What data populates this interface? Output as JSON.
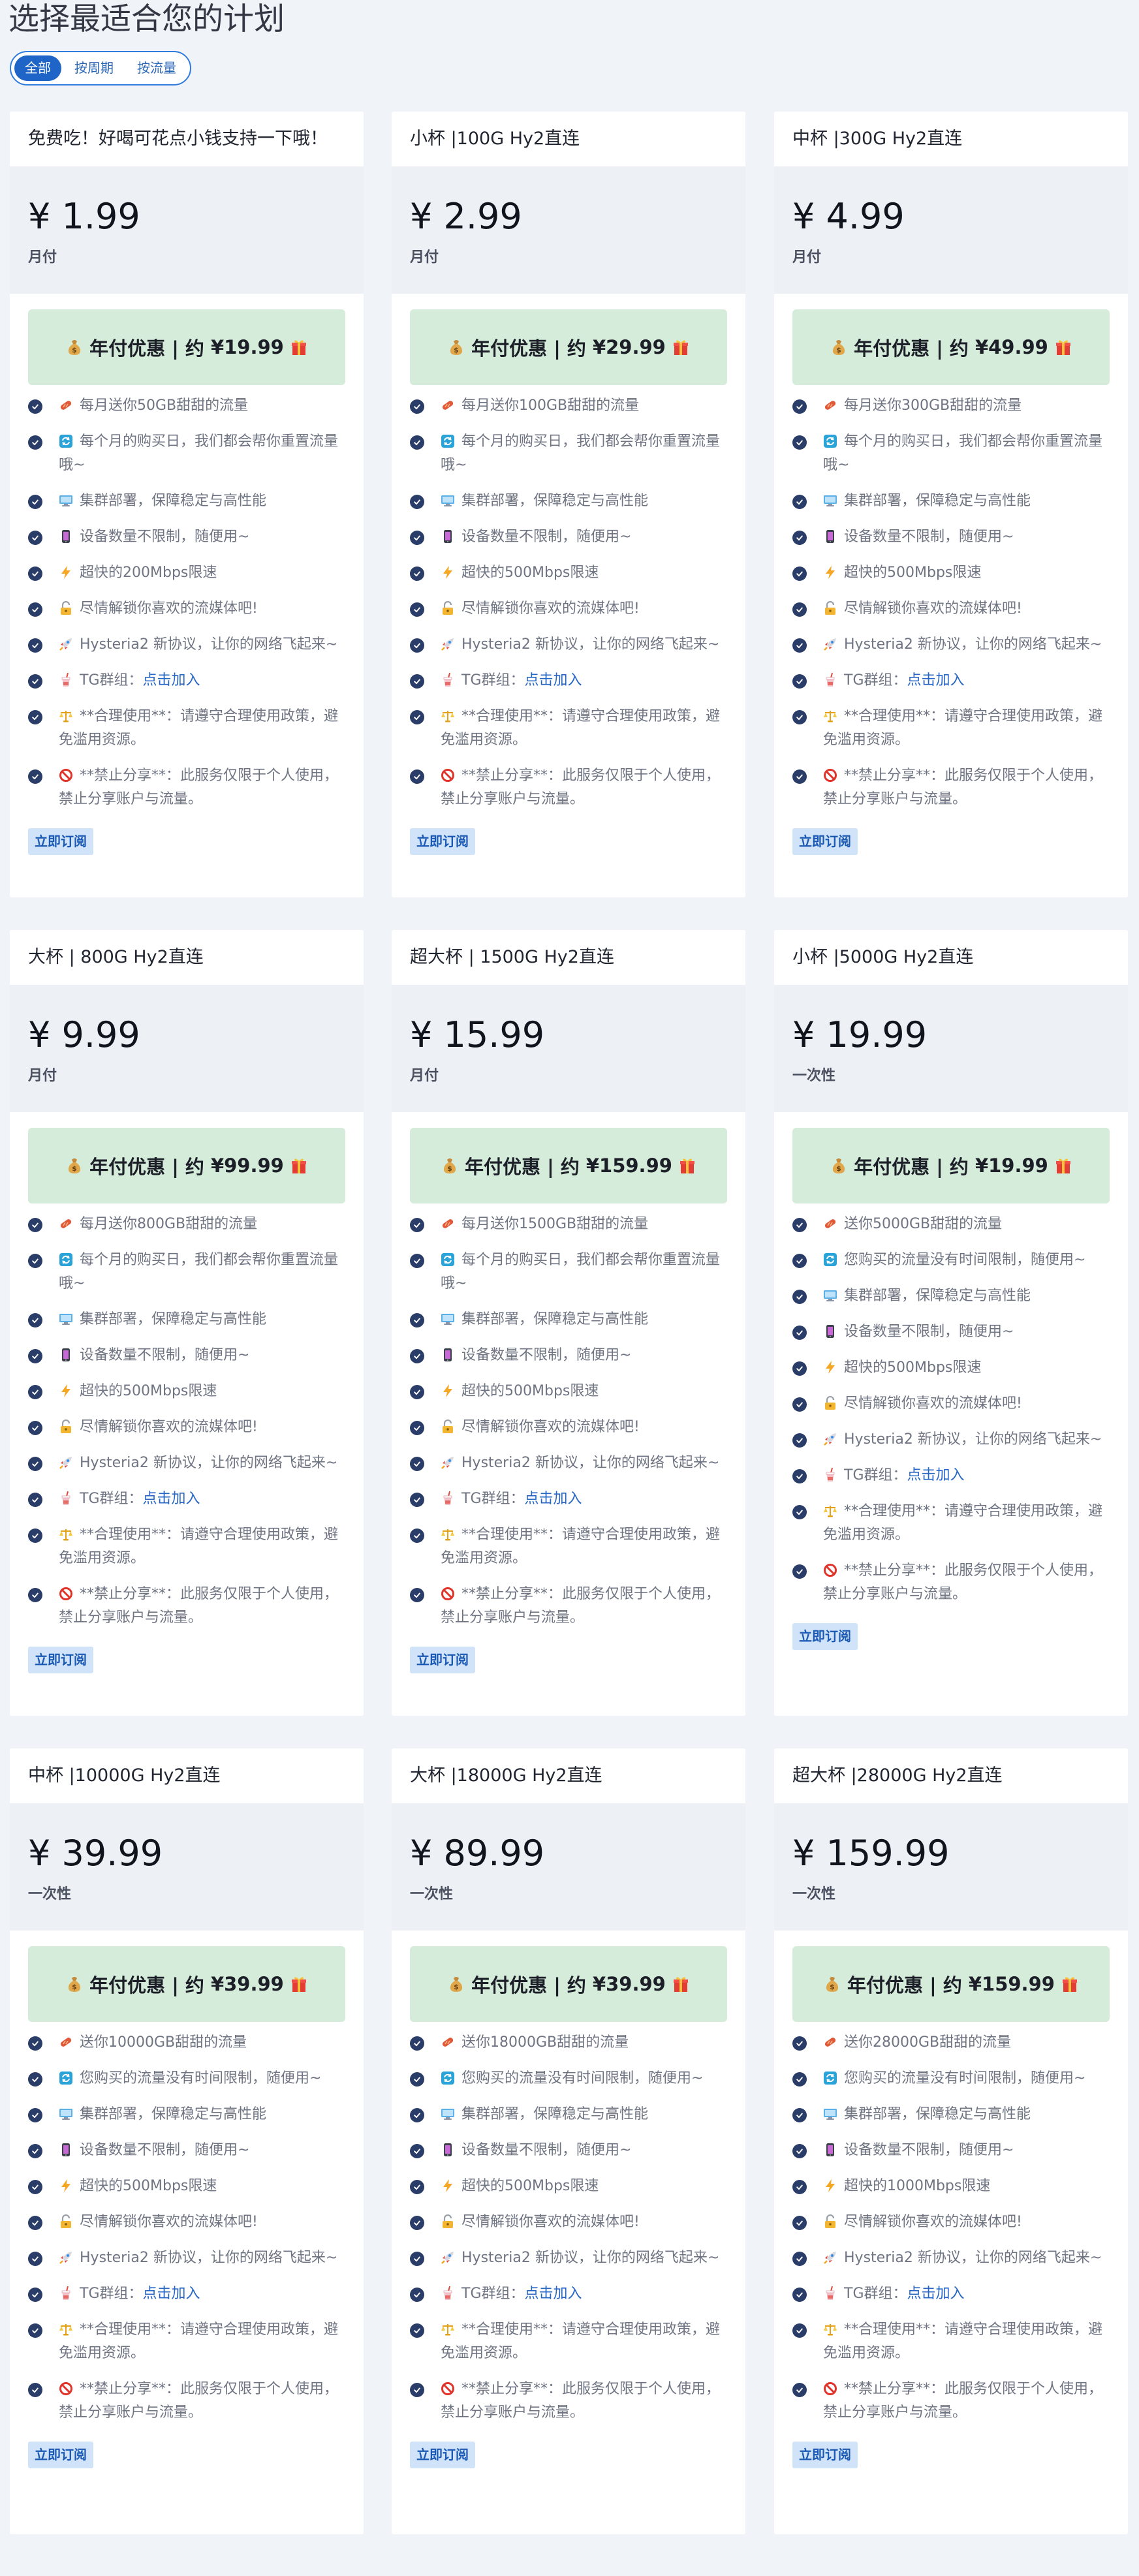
{
  "page": {
    "title": "选择最适合您的计划"
  },
  "filters": [
    {
      "label": "全部",
      "active": true
    },
    {
      "label": "按周期",
      "active": false
    },
    {
      "label": "按流量",
      "active": false
    }
  ],
  "colors": {
    "accent": "#1f65c7",
    "check": "#2a3d68",
    "banner_bg": "#d5ecda",
    "price_bg": "#edf0f4",
    "button_bg": "#d1e3f8",
    "link": "#2766c4"
  },
  "plans": [
    {
      "name": "免费吃！好喝可花点小钱支持一下哦！",
      "price": "¥ 1.99",
      "period": "月付",
      "discount_label": "年付优惠 | 约",
      "discount_price": "¥19.99",
      "features": [
        {
          "icon": "sausage-icon",
          "text": "每月送你50GB甜甜的流量"
        },
        {
          "icon": "repeat-icon",
          "text": "每个月的购买日，我们都会帮你重置流量哦~"
        },
        {
          "icon": "monitor-icon",
          "text": "集群部署，保障稳定与高性能"
        },
        {
          "icon": "phone-icon",
          "text": "设备数量不限制，随便用~"
        },
        {
          "icon": "lightning-icon",
          "text": "超快的200Mbps限速"
        },
        {
          "icon": "unlock-icon",
          "text": "尽情解锁你喜欢的流媒体吧!"
        },
        {
          "icon": "rocket-icon",
          "text": "Hysteria2 新协议，让你的网络飞起来~"
        },
        {
          "icon": "drink-icon",
          "text": "TG群组：",
          "link": "点击加入"
        },
        {
          "icon": "scale-icon",
          "text": "**合理使用**：请遵守合理使用政策，避免滥用资源。"
        },
        {
          "icon": "prohibited-icon",
          "text": "**禁止分享**：此服务仅限于个人使用，禁止分享账户与流量。"
        }
      ],
      "button_label": "立即订阅"
    },
    {
      "name": "小杯 |100G Hy2直连",
      "price": "¥ 2.99",
      "period": "月付",
      "discount_label": "年付优惠 | 约",
      "discount_price": "¥29.99",
      "features": [
        {
          "icon": "sausage-icon",
          "text": "每月送你100GB甜甜的流量"
        },
        {
          "icon": "repeat-icon",
          "text": "每个月的购买日，我们都会帮你重置流量哦~"
        },
        {
          "icon": "monitor-icon",
          "text": "集群部署，保障稳定与高性能"
        },
        {
          "icon": "phone-icon",
          "text": "设备数量不限制，随便用~"
        },
        {
          "icon": "lightning-icon",
          "text": "超快的500Mbps限速"
        },
        {
          "icon": "unlock-icon",
          "text": "尽情解锁你喜欢的流媒体吧!"
        },
        {
          "icon": "rocket-icon",
          "text": "Hysteria2 新协议，让你的网络飞起来~"
        },
        {
          "icon": "drink-icon",
          "text": "TG群组：",
          "link": "点击加入"
        },
        {
          "icon": "scale-icon",
          "text": "**合理使用**：请遵守合理使用政策，避免滥用资源。"
        },
        {
          "icon": "prohibited-icon",
          "text": "**禁止分享**：此服务仅限于个人使用，禁止分享账户与流量。"
        }
      ],
      "button_label": "立即订阅"
    },
    {
      "name": "中杯 |300G Hy2直连",
      "price": "¥ 4.99",
      "period": "月付",
      "discount_label": "年付优惠 | 约",
      "discount_price": "¥49.99",
      "features": [
        {
          "icon": "sausage-icon",
          "text": "每月送你300GB甜甜的流量"
        },
        {
          "icon": "repeat-icon",
          "text": "每个月的购买日，我们都会帮你重置流量哦~"
        },
        {
          "icon": "monitor-icon",
          "text": "集群部署，保障稳定与高性能"
        },
        {
          "icon": "phone-icon",
          "text": "设备数量不限制，随便用~"
        },
        {
          "icon": "lightning-icon",
          "text": "超快的500Mbps限速"
        },
        {
          "icon": "unlock-icon",
          "text": "尽情解锁你喜欢的流媒体吧!"
        },
        {
          "icon": "rocket-icon",
          "text": "Hysteria2 新协议，让你的网络飞起来~"
        },
        {
          "icon": "drink-icon",
          "text": "TG群组：",
          "link": "点击加入"
        },
        {
          "icon": "scale-icon",
          "text": "**合理使用**：请遵守合理使用政策，避免滥用资源。"
        },
        {
          "icon": "prohibited-icon",
          "text": "**禁止分享**：此服务仅限于个人使用，禁止分享账户与流量。"
        }
      ],
      "button_label": "立即订阅"
    },
    {
      "name": "大杯 | 800G Hy2直连",
      "price": "¥ 9.99",
      "period": "月付",
      "discount_label": "年付优惠 | 约",
      "discount_price": "¥99.99",
      "features": [
        {
          "icon": "sausage-icon",
          "text": "每月送你800GB甜甜的流量"
        },
        {
          "icon": "repeat-icon",
          "text": "每个月的购买日，我们都会帮你重置流量哦~"
        },
        {
          "icon": "monitor-icon",
          "text": "集群部署，保障稳定与高性能"
        },
        {
          "icon": "phone-icon",
          "text": "设备数量不限制，随便用~"
        },
        {
          "icon": "lightning-icon",
          "text": "超快的500Mbps限速"
        },
        {
          "icon": "unlock-icon",
          "text": "尽情解锁你喜欢的流媒体吧!"
        },
        {
          "icon": "rocket-icon",
          "text": "Hysteria2 新协议，让你的网络飞起来~"
        },
        {
          "icon": "drink-icon",
          "text": "TG群组：",
          "link": "点击加入"
        },
        {
          "icon": "scale-icon",
          "text": "**合理使用**：请遵守合理使用政策，避免滥用资源。"
        },
        {
          "icon": "prohibited-icon",
          "text": "**禁止分享**：此服务仅限于个人使用，禁止分享账户与流量。"
        }
      ],
      "button_label": "立即订阅"
    },
    {
      "name": "超大杯 | 1500G Hy2直连",
      "price": "¥ 15.99",
      "period": "月付",
      "discount_label": "年付优惠 | 约",
      "discount_price": "¥159.99",
      "features": [
        {
          "icon": "sausage-icon",
          "text": "每月送你1500GB甜甜的流量"
        },
        {
          "icon": "repeat-icon",
          "text": "每个月的购买日，我们都会帮你重置流量哦~"
        },
        {
          "icon": "monitor-icon",
          "text": "集群部署，保障稳定与高性能"
        },
        {
          "icon": "phone-icon",
          "text": "设备数量不限制，随便用~"
        },
        {
          "icon": "lightning-icon",
          "text": "超快的500Mbps限速"
        },
        {
          "icon": "unlock-icon",
          "text": "尽情解锁你喜欢的流媒体吧!"
        },
        {
          "icon": "rocket-icon",
          "text": "Hysteria2 新协议，让你的网络飞起来~"
        },
        {
          "icon": "drink-icon",
          "text": "TG群组：",
          "link": "点击加入"
        },
        {
          "icon": "scale-icon",
          "text": "**合理使用**：请遵守合理使用政策，避免滥用资源。"
        },
        {
          "icon": "prohibited-icon",
          "text": "**禁止分享**：此服务仅限于个人使用，禁止分享账户与流量。"
        }
      ],
      "button_label": "立即订阅"
    },
    {
      "name": "小杯 |5000G Hy2直连",
      "price": "¥ 19.99",
      "period": "一次性",
      "discount_label": "年付优惠 | 约",
      "discount_price": "¥19.99",
      "features": [
        {
          "icon": "sausage-icon",
          "text": "送你5000GB甜甜的流量"
        },
        {
          "icon": "repeat-icon",
          "text": "您购买的流量没有时间限制，随便用~"
        },
        {
          "icon": "monitor-icon",
          "text": "集群部署，保障稳定与高性能"
        },
        {
          "icon": "phone-icon",
          "text": "设备数量不限制，随便用~"
        },
        {
          "icon": "lightning-icon",
          "text": "超快的500Mbps限速"
        },
        {
          "icon": "unlock-icon",
          "text": "尽情解锁你喜欢的流媒体吧!"
        },
        {
          "icon": "rocket-icon",
          "text": "Hysteria2 新协议，让你的网络飞起来~"
        },
        {
          "icon": "drink-icon",
          "text": "TG群组：",
          "link": "点击加入"
        },
        {
          "icon": "scale-icon",
          "text": "**合理使用**：请遵守合理使用政策，避免滥用资源。"
        },
        {
          "icon": "prohibited-icon",
          "text": "**禁止分享**：此服务仅限于个人使用，禁止分享账户与流量。"
        }
      ],
      "button_label": "立即订阅"
    },
    {
      "name": "中杯 |10000G Hy2直连",
      "price": "¥ 39.99",
      "period": "一次性",
      "discount_label": "年付优惠 | 约",
      "discount_price": "¥39.99",
      "features": [
        {
          "icon": "sausage-icon",
          "text": "送你10000GB甜甜的流量"
        },
        {
          "icon": "repeat-icon",
          "text": "您购买的流量没有时间限制，随便用~"
        },
        {
          "icon": "monitor-icon",
          "text": "集群部署，保障稳定与高性能"
        },
        {
          "icon": "phone-icon",
          "text": "设备数量不限制，随便用~"
        },
        {
          "icon": "lightning-icon",
          "text": "超快的500Mbps限速"
        },
        {
          "icon": "unlock-icon",
          "text": "尽情解锁你喜欢的流媒体吧!"
        },
        {
          "icon": "rocket-icon",
          "text": "Hysteria2 新协议，让你的网络飞起来~"
        },
        {
          "icon": "drink-icon",
          "text": "TG群组：",
          "link": "点击加入"
        },
        {
          "icon": "scale-icon",
          "text": "**合理使用**：请遵守合理使用政策，避免滥用资源。"
        },
        {
          "icon": "prohibited-icon",
          "text": "**禁止分享**：此服务仅限于个人使用，禁止分享账户与流量。"
        }
      ],
      "button_label": "立即订阅"
    },
    {
      "name": "大杯 |18000G Hy2直连",
      "price": "¥ 89.99",
      "period": "一次性",
      "discount_label": "年付优惠 | 约",
      "discount_price": "¥39.99",
      "features": [
        {
          "icon": "sausage-icon",
          "text": "送你18000GB甜甜的流量"
        },
        {
          "icon": "repeat-icon",
          "text": "您购买的流量没有时间限制，随便用~"
        },
        {
          "icon": "monitor-icon",
          "text": "集群部署，保障稳定与高性能"
        },
        {
          "icon": "phone-icon",
          "text": "设备数量不限制，随便用~"
        },
        {
          "icon": "lightning-icon",
          "text": "超快的500Mbps限速"
        },
        {
          "icon": "unlock-icon",
          "text": "尽情解锁你喜欢的流媒体吧!"
        },
        {
          "icon": "rocket-icon",
          "text": "Hysteria2 新协议，让你的网络飞起来~"
        },
        {
          "icon": "drink-icon",
          "text": "TG群组：",
          "link": "点击加入"
        },
        {
          "icon": "scale-icon",
          "text": "**合理使用**：请遵守合理使用政策，避免滥用资源。"
        },
        {
          "icon": "prohibited-icon",
          "text": "**禁止分享**：此服务仅限于个人使用，禁止分享账户与流量。"
        }
      ],
      "button_label": "立即订阅"
    },
    {
      "name": "超大杯 |28000G Hy2直连",
      "price": "¥ 159.99",
      "period": "一次性",
      "discount_label": "年付优惠 | 约",
      "discount_price": "¥159.99",
      "features": [
        {
          "icon": "sausage-icon",
          "text": "送你28000GB甜甜的流量"
        },
        {
          "icon": "repeat-icon",
          "text": "您购买的流量没有时间限制，随便用~"
        },
        {
          "icon": "monitor-icon",
          "text": "集群部署，保障稳定与高性能"
        },
        {
          "icon": "phone-icon",
          "text": "设备数量不限制，随便用~"
        },
        {
          "icon": "lightning-icon",
          "text": "超快的1000Mbps限速"
        },
        {
          "icon": "unlock-icon",
          "text": "尽情解锁你喜欢的流媒体吧!"
        },
        {
          "icon": "rocket-icon",
          "text": "Hysteria2 新协议，让你的网络飞起来~"
        },
        {
          "icon": "drink-icon",
          "text": "TG群组：",
          "link": "点击加入"
        },
        {
          "icon": "scale-icon",
          "text": "**合理使用**：请遵守合理使用政策，避免滥用资源。"
        },
        {
          "icon": "prohibited-icon",
          "text": "**禁止分享**：此服务仅限于个人使用，禁止分享账户与流量。"
        }
      ],
      "button_label": "立即订阅"
    }
  ]
}
